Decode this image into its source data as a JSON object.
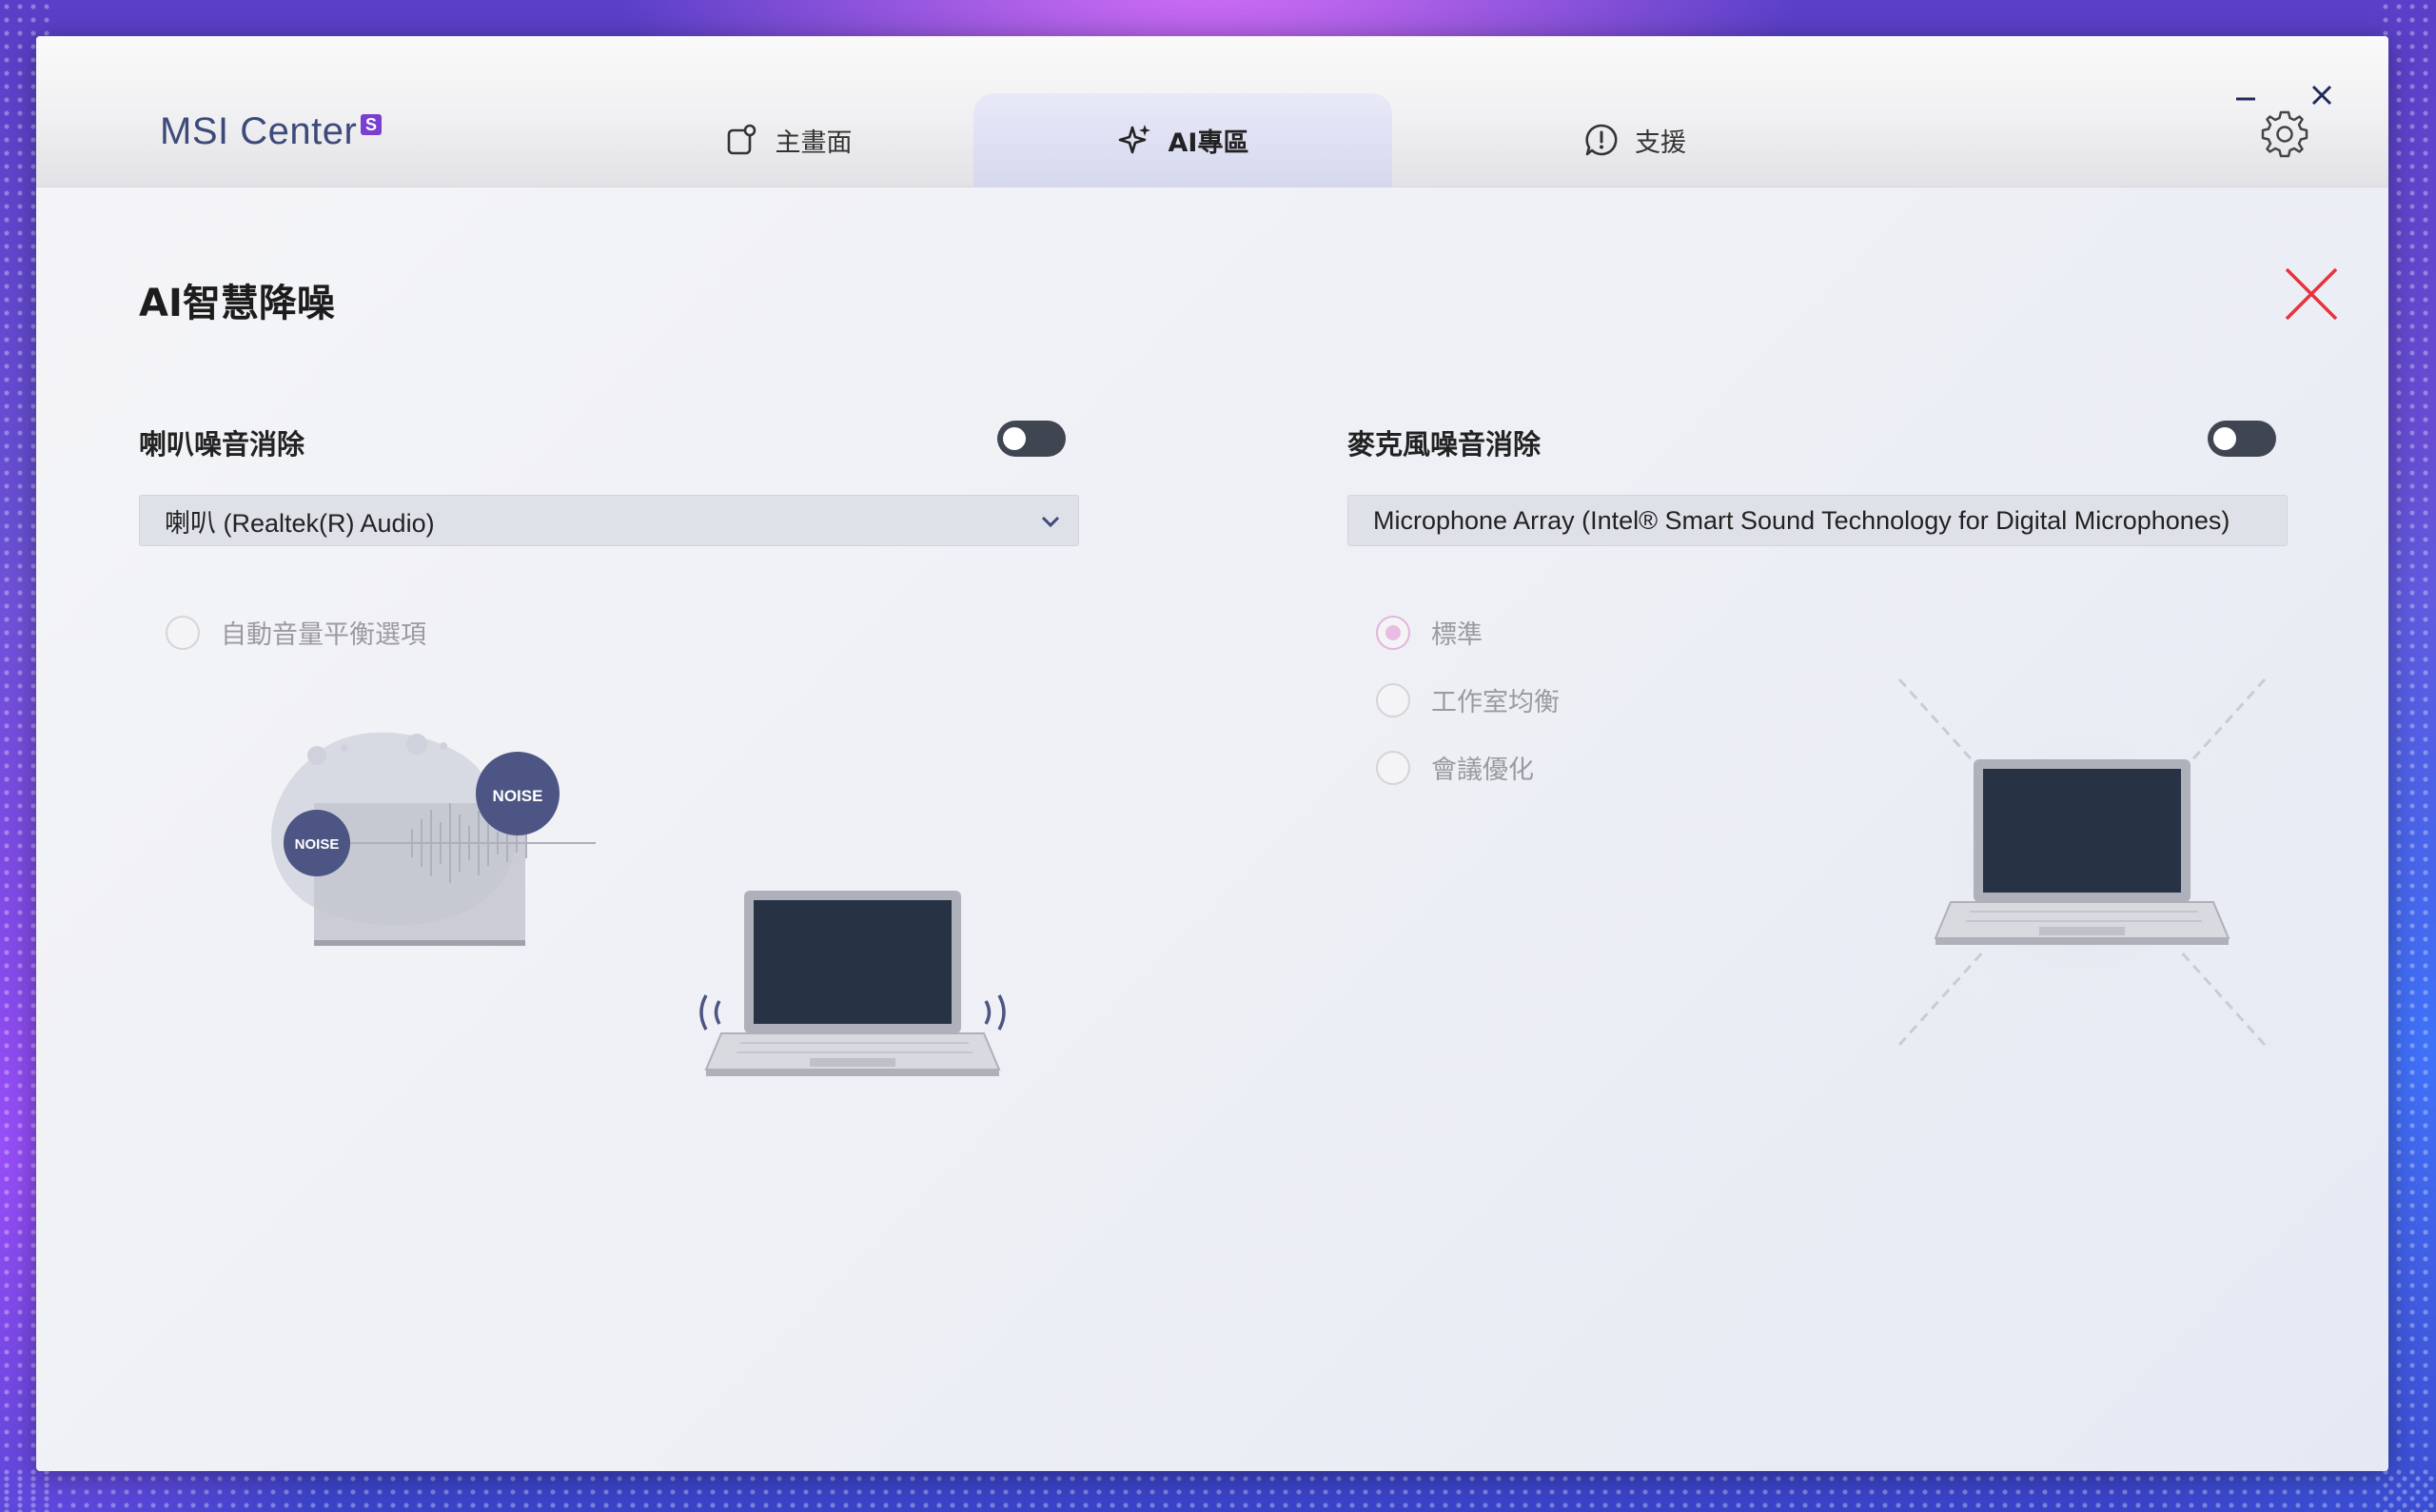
{
  "app": {
    "name": "MSI Center",
    "badge": "S"
  },
  "tabs": [
    {
      "label": "主畫面",
      "icon": "home-icon",
      "active": false
    },
    {
      "label": "AI專區",
      "icon": "ai-sparkle-icon",
      "active": true
    },
    {
      "label": "支援",
      "icon": "support-alert-icon",
      "active": false
    }
  ],
  "page": {
    "title": "AI智慧降噪"
  },
  "speaker": {
    "label": "喇叭噪音消除",
    "enabled": false,
    "device": "喇叭 (Realtek(R) Audio)",
    "option_label": "自動音量平衡選項",
    "noise_label_1": "NOISE",
    "noise_label_2": "NOISE"
  },
  "microphone": {
    "label": "麥克風噪音消除",
    "enabled": false,
    "device": "Microphone Array (Intel® Smart Sound Technology for Digital Microphones)",
    "modes": [
      {
        "label": "標準",
        "selected": true
      },
      {
        "label": "工作室均衡",
        "selected": false
      },
      {
        "label": "會議優化",
        "selected": false
      }
    ]
  },
  "colors": {
    "accent_close": "#e8323c",
    "toggle_off": "#3f4651",
    "radio_selected": "#e8bde2"
  }
}
